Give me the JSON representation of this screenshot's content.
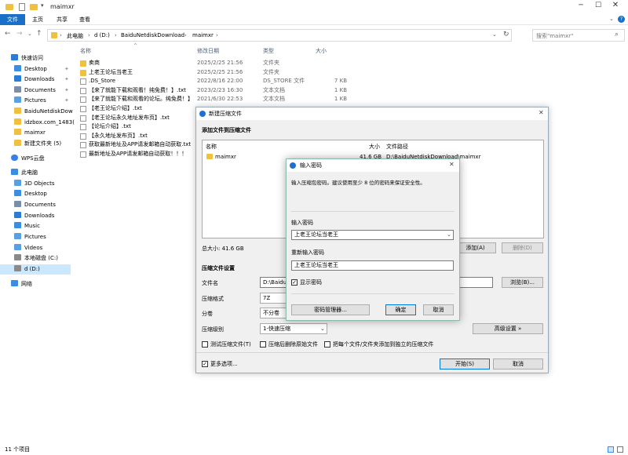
{
  "window": {
    "title": "maimxr"
  },
  "ribbon": {
    "tabs": [
      "文件",
      "主页",
      "共享",
      "查看"
    ]
  },
  "address": {
    "path": [
      "此电脑",
      "d (D:)",
      "BaiduNetdiskDownload",
      "maimxr"
    ],
    "search_placeholder": "搜索\"maimxr\""
  },
  "nav": {
    "items": [
      {
        "label": "快速访问",
        "color": "#2b7cd3"
      },
      {
        "label": "Desktop",
        "color": "#3a8de0"
      },
      {
        "label": "Downloads",
        "color": "#2b7cd3"
      },
      {
        "label": "Documents",
        "color": "#7a8ea8"
      },
      {
        "label": "Pictures",
        "color": "#5aa0e0"
      },
      {
        "label": "BaiduNetdiskDow",
        "color": "#f0c040"
      },
      {
        "label": "idzbox.com_1483(",
        "color": "#f0c040"
      },
      {
        "label": "maimxr",
        "color": "#f0c040"
      },
      {
        "label": "新建文件夹 (5)",
        "color": "#f0c040"
      },
      {
        "label": "WPS云盘",
        "color": "#3b7de9"
      },
      {
        "label": "此电脑",
        "color": "#3a8de0"
      },
      {
        "label": "3D Objects",
        "color": "#5aa0e0"
      },
      {
        "label": "Desktop",
        "color": "#3a8de0"
      },
      {
        "label": "Documents",
        "color": "#7a8ea8"
      },
      {
        "label": "Downloads",
        "color": "#2b7cd3"
      },
      {
        "label": "Music",
        "color": "#3a8de0"
      },
      {
        "label": "Pictures",
        "color": "#5aa0e0"
      },
      {
        "label": "Videos",
        "color": "#5aa0e0"
      },
      {
        "label": "本地磁盘 (C:)",
        "color": "#8a8a8a"
      },
      {
        "label": "d (D:)",
        "color": "#8a8a8a"
      },
      {
        "label": "网络",
        "color": "#3a8de0"
      }
    ]
  },
  "files": {
    "headers": {
      "name": "名称",
      "date": "修改日期",
      "type": "类型",
      "size": "大小"
    },
    "rows": [
      {
        "name": "卖商",
        "date": "2025/2/25 21:56",
        "type": "文件夹",
        "size": "",
        "icon": "folder"
      },
      {
        "name": "上老王论坛当老王",
        "date": "2025/2/25 21:56",
        "type": "文件夹",
        "size": "",
        "icon": "folder"
      },
      {
        "name": ".DS_Store",
        "date": "2022/8/16 22:00",
        "type": "DS_STORE 文件",
        "size": "7 KB",
        "icon": "file"
      },
      {
        "name": "【来了就能下载和观看！纯免费！】.txt",
        "date": "2023/2/23 16:30",
        "type": "文本文档",
        "size": "1 KB",
        "icon": "file"
      },
      {
        "name": "【来了就能下载和观看的论坛。纯免费！】",
        "date": "2021/6/30 22:53",
        "type": "文本文档",
        "size": "1 KB",
        "icon": "file"
      },
      {
        "name": "【老王论坛介绍】.txt",
        "date": "",
        "type": "",
        "size": "",
        "icon": "file"
      },
      {
        "name": "【老王论坛永久地址发布页】.txt",
        "date": "",
        "type": "",
        "size": "",
        "icon": "file"
      },
      {
        "name": "【论坛介绍】.txt",
        "date": "",
        "type": "",
        "size": "",
        "icon": "file"
      },
      {
        "name": "【永久地址发布页】.txt",
        "date": "",
        "type": "",
        "size": "",
        "icon": "file"
      },
      {
        "name": "获取最新地址及APP请发邮箱自动获取.txt",
        "date": "",
        "type": "",
        "size": "",
        "icon": "file"
      },
      {
        "name": "最新地址及APP请发邮箱自动获取！！！",
        "date": "",
        "type": "",
        "size": "",
        "icon": "file"
      }
    ]
  },
  "status": {
    "count": "11 个项目"
  },
  "compress": {
    "title": "新建压缩文件",
    "section_add": "添加文件到压缩文件",
    "col_name": "名称",
    "col_size": "大小",
    "col_path": "文件路径",
    "item": {
      "name": "maimxr",
      "size": "41.6 GB",
      "path": "D:\\BaiduNetdiskDownload\\maimxr"
    },
    "total_size": "总大小: 41.6 GB",
    "add_btn": "添加(A)",
    "delete_btn": "删除(D)",
    "settings_title": "压缩文件设置",
    "filename_label": "文件名",
    "filename_value": "D:\\Baidul",
    "browse_btn": "浏览(B)...",
    "format_label": "压缩格式",
    "format_value": "7Z",
    "split_label": "分卷",
    "split_value": "不分卷",
    "level_label": "压缩级别",
    "level_value": "1-快速压缩",
    "advanced_btn": "高级设置 »",
    "opt_test": "测试压缩文件(T)",
    "opt_delete": "压缩后删除原始文件",
    "opt_separate": "把每个文件/文件夹添加到独立的压缩文件",
    "more_options": "更多选项...",
    "start_btn": "开始(S)",
    "cancel_btn": "取消"
  },
  "password": {
    "title": "输入密码",
    "hint": "输入压缩包密码。建议使用至少 8 位的密码来保证安全性。",
    "enter_label": "输入密码",
    "enter_value": "上老王论坛当老王",
    "reenter_label": "重新输入密码",
    "reenter_value": "上老王论坛当老王",
    "show_password": "显示密码",
    "manager_btn": "密码管理器...",
    "ok_btn": "确定",
    "cancel_btn": "取消"
  }
}
